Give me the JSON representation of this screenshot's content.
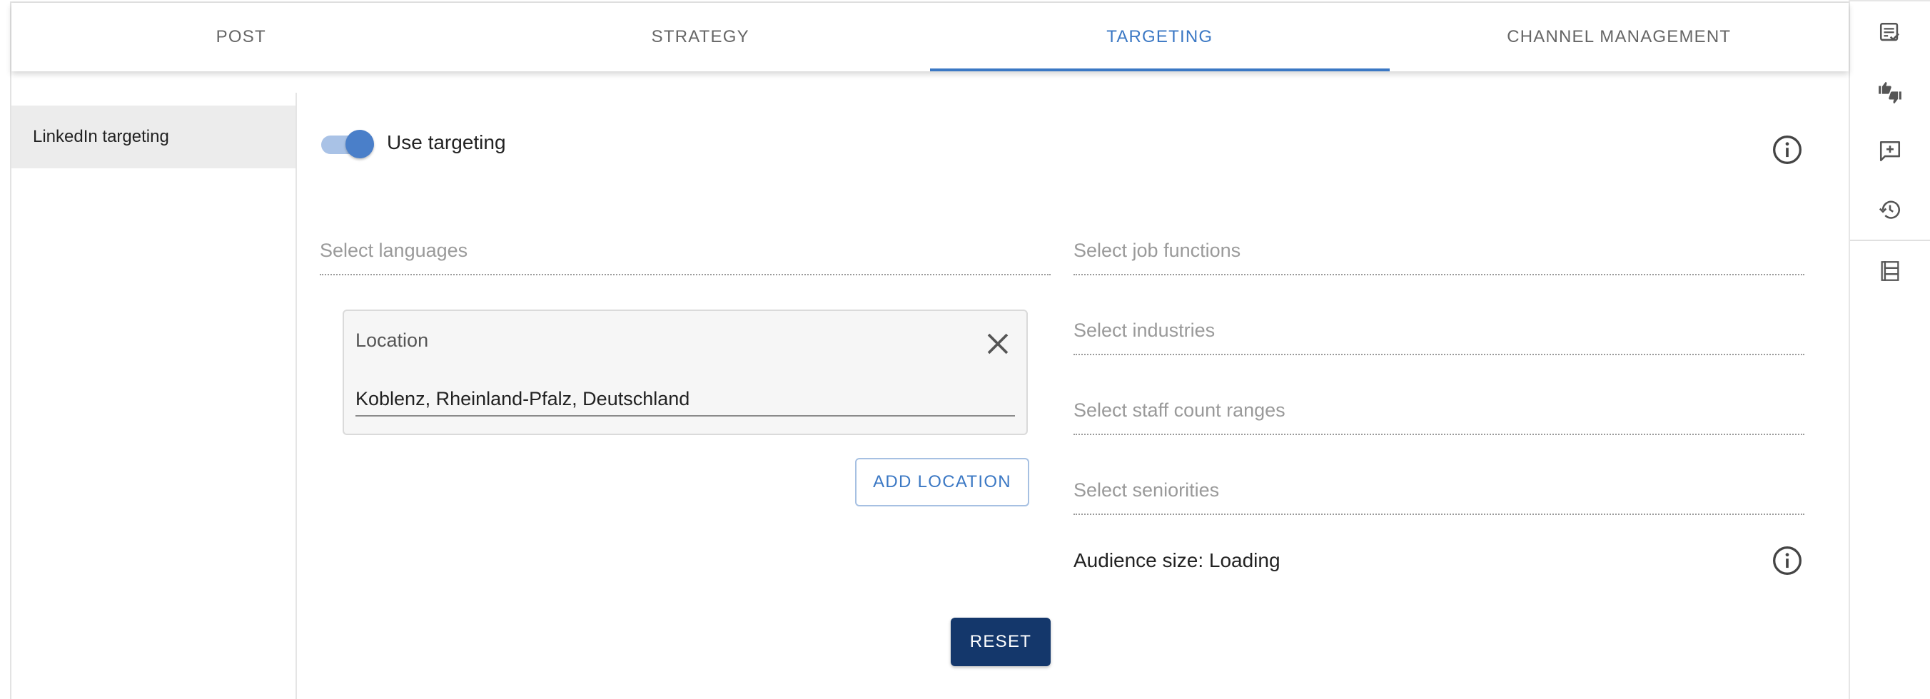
{
  "tabs": [
    {
      "label": "POST",
      "active": false
    },
    {
      "label": "STRATEGY",
      "active": false
    },
    {
      "label": "TARGETING",
      "active": true
    },
    {
      "label": "CHANNEL MANAGEMENT",
      "active": false
    }
  ],
  "sidebar": {
    "items": [
      {
        "label": "LinkedIn targeting",
        "selected": true
      }
    ]
  },
  "targeting": {
    "toggle": {
      "label": "Use targeting",
      "on": true
    },
    "languages_placeholder": "Select languages",
    "location": {
      "label": "Location",
      "value": "Koblenz, Rheinland-Pfalz, Deutschland"
    },
    "add_location_label": "ADD LOCATION",
    "job_functions_placeholder": "Select job functions",
    "industries_placeholder": "Select industries",
    "staff_count_placeholder": "Select staff count ranges",
    "seniorities_placeholder": "Select seniorities",
    "audience_size": "Audience size: Loading",
    "reset_label": "RESET"
  },
  "rail": {
    "icons": [
      "checklist-icon",
      "thumbs-up-down-icon",
      "add-comment-icon",
      "history-icon",
      "list-view-icon"
    ]
  },
  "colors": {
    "accent": "#3b78c4",
    "primary_button": "#14376b"
  }
}
